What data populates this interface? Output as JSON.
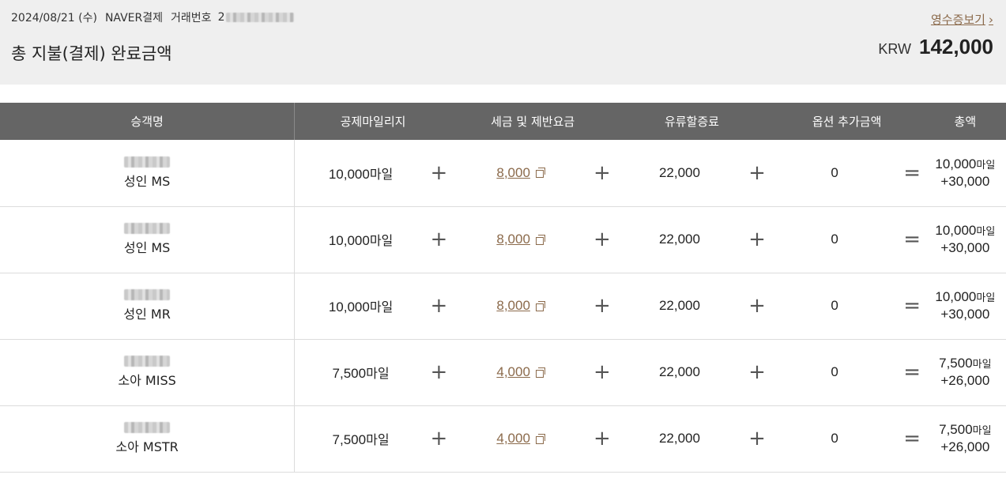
{
  "summary": {
    "date": "2024/08/21 (수)",
    "method": "NAVER결제",
    "txid_label": "거래번호",
    "txid_prefix": "2",
    "total_label": "총 지불(결제) 완료금액",
    "receipt_link": "영수증보기",
    "currency": "KRW",
    "amount": "142,000"
  },
  "table": {
    "headers": [
      "승객명",
      "공제마일리지",
      "세금 및 제반요금",
      "유류할증료",
      "옵션 추가금액",
      "총액"
    ],
    "operators": {
      "plus": "+",
      "equals": "="
    },
    "rows": [
      {
        "passenger": "성인 MS",
        "miles": "10,000",
        "miles_unit": "마일",
        "tax": "8,000",
        "fuel": "22,000",
        "option": "0",
        "total_miles": "10,000",
        "total_unit": "마일",
        "total_cash": "+30,000"
      },
      {
        "passenger": "성인 MS",
        "miles": "10,000",
        "miles_unit": "마일",
        "tax": "8,000",
        "fuel": "22,000",
        "option": "0",
        "total_miles": "10,000",
        "total_unit": "마일",
        "total_cash": "+30,000"
      },
      {
        "passenger": "성인 MR",
        "miles": "10,000",
        "miles_unit": "마일",
        "tax": "8,000",
        "fuel": "22,000",
        "option": "0",
        "total_miles": "10,000",
        "total_unit": "마일",
        "total_cash": "+30,000"
      },
      {
        "passenger": "소아 MISS",
        "miles": "7,500",
        "miles_unit": "마일",
        "tax": "4,000",
        "fuel": "22,000",
        "option": "0",
        "total_miles": "7,500",
        "total_unit": "마일",
        "total_cash": "+26,000"
      },
      {
        "passenger": "소아 MSTR",
        "miles": "7,500",
        "miles_unit": "마일",
        "tax": "4,000",
        "fuel": "22,000",
        "option": "0",
        "total_miles": "7,500",
        "total_unit": "마일",
        "total_cash": "+26,000"
      }
    ]
  },
  "icons": {
    "receipt_chevron": "chevron-right-icon",
    "tax_popup": "popup-window-icon",
    "masked_text": "redacted-blur"
  },
  "colors": {
    "summary_bg": "#efefef",
    "header_bg": "#656565",
    "link": "#8b6a4b"
  }
}
